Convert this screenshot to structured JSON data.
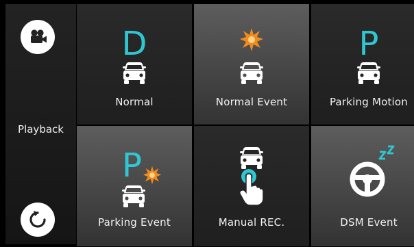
{
  "sidebar": {
    "top_icon": "video-camera-icon",
    "label": "Playback",
    "bottom_icon": "refresh-icon"
  },
  "tiles": [
    {
      "label": "Normal",
      "glyph": "D",
      "icon": "car-icon",
      "shade": "dark"
    },
    {
      "label": "Normal Event",
      "glyph": "",
      "icon": "car-with-burst-icon",
      "shade": "light"
    },
    {
      "label": "Parking Motion",
      "glyph": "P",
      "icon": "car-icon",
      "shade": "dark"
    },
    {
      "label": "Parking Event",
      "glyph": "P",
      "icon": "car-with-burst-icon",
      "shade": "light"
    },
    {
      "label": "Manual REC.",
      "glyph": "",
      "icon": "car-with-hand-tap-icon",
      "shade": "dark"
    },
    {
      "label": "DSM Event",
      "glyph": "zz",
      "icon": "steering-wheel-icon",
      "shade": "light"
    }
  ],
  "colors": {
    "accent_cyan": "#2fc7d2",
    "accent_orange": "#f28b1e",
    "tile_dark": "#252525",
    "tile_light": "#4a4a4a"
  }
}
